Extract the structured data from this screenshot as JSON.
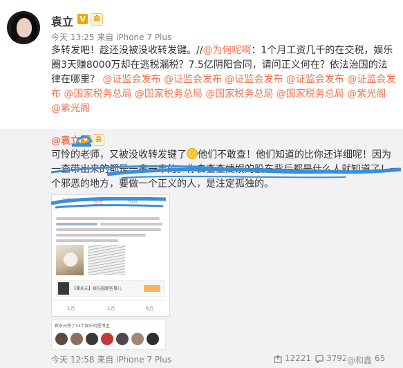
{
  "post": {
    "author": "袁立",
    "verified_badge": "V",
    "vip_badge": "会",
    "timestamp": "今天 13:25 来自 iPhone 7 Plus",
    "text_before_link": "多转发吧！趁还没被没收转发键。//",
    "mention_1": "@为何呢啊",
    "text_after_link": "：1个月工资几千的在交税，娱乐圈3天赚8000万却在逃税漏税？7.5亿阴阳合同，请问正义何在？依法治国的法律在哪里？",
    "mentions_tail": "@证监会发布 @证监会发布 @证监会发布 @证监会发布 @证监会发布 @国家税务总局 @国家税务总局 @国家税务总局 @国家税务总局 @紫光阁 @紫光阁"
  },
  "repost": {
    "author": "@袁立",
    "verified_badge": "V",
    "vip_badge": "会",
    "text_part1": "可怜的",
    "text_part2": "老师，又被没收转发键了",
    "text_part3": "他们不敢查！他们知道的比你还详细呢！因为一查带出来的都是一串一串的。你去查查婕娱的股东背后都是什么人就知道了！一个邪恶的地方，要做一个正义的人，是注定孤独的。",
    "timestamp": "今天 12:58 来自 iPhone 7 Plus",
    "share_count": "12221",
    "comment_count": "3792",
    "like_count": "65"
  },
  "embedded": {
    "tab_1": "主页",
    "tab_2": "微博",
    "tab_3": "相册",
    "card_label": "【崔永元】娱乐圈那些事儿",
    "stat_1": "1万",
    "stat_2": "1万",
    "stat_3": "6万",
    "strip_text": "崔永元等了43个娱乐明星博主"
  },
  "watermark": "@和鑫",
  "colors": {
    "link": "#eb7350",
    "repost_bg": "#f2f2f5",
    "annotation": "#3b8fd6",
    "meta": "#808080"
  }
}
